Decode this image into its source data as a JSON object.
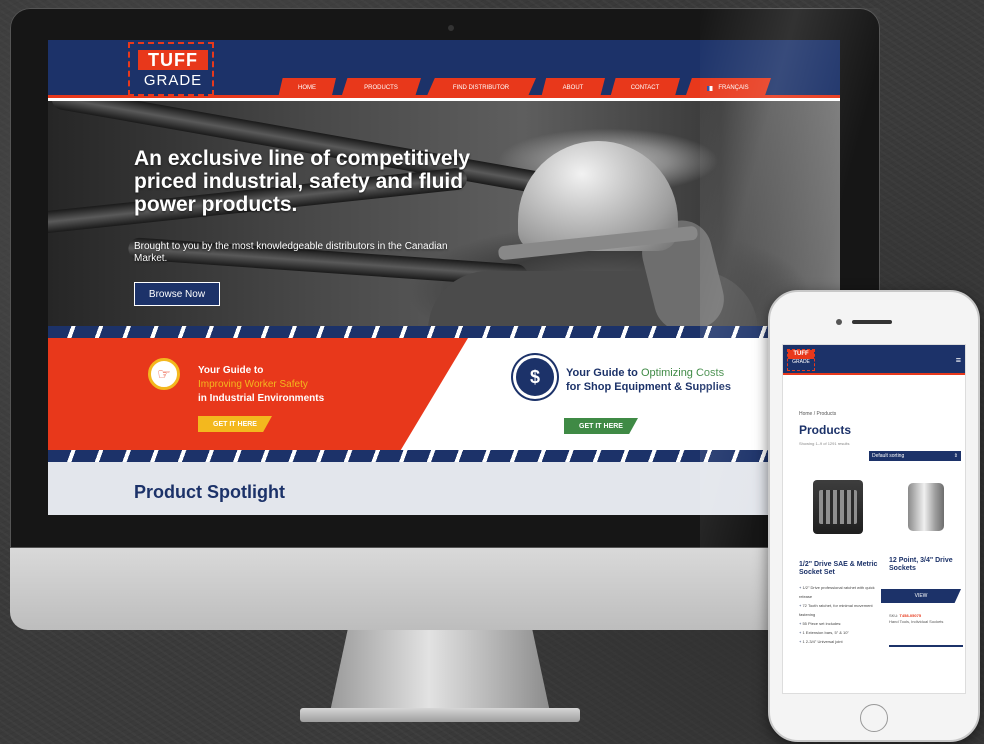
{
  "website": {
    "logo": {
      "top": "TUFF",
      "bottom": "GRADE"
    },
    "nav": [
      {
        "label": "Home",
        "w": 58
      },
      {
        "label": "Products",
        "w": 80
      },
      {
        "label": "Find Distributor",
        "w": 110
      },
      {
        "label": "About",
        "w": 64
      },
      {
        "label": "Contact",
        "w": 70
      },
      {
        "label": "Français",
        "w": 86,
        "flag": true
      }
    ],
    "hero": {
      "title": "An exclusive line of competitively priced industrial, safety and fluid power products.",
      "subtitle": "Brought to you by the most knowledgeable distributors in the Canadian Market.",
      "button": "Browse Now"
    },
    "guide_safety": {
      "prefix": "Your Guide to",
      "highlight": "Improving Worker Safety",
      "suffix": "in Industrial Environments",
      "button": "GET IT HERE"
    },
    "guide_costs": {
      "prefix": "Your Guide to",
      "highlight": "Optimizing Costs",
      "suffix": "for Shop Equipment & Supplies",
      "button": "GET IT HERE"
    },
    "spotlight": {
      "title": "Product Spotlight"
    }
  },
  "mobile": {
    "logo": {
      "top": "TUFF",
      "bottom": "GRADE"
    },
    "menu_icon": "≡",
    "breadcrumb": "Home / Products",
    "title": "Products",
    "count": "Showing 1–9 of 1291 results",
    "sort": "Default sorting",
    "product1": {
      "title": "1/2\" Drive SAE & Metric Socket Set",
      "features": [
        "1/2\" Drive professional ratchet with quick release",
        "72 Tooth ratchet, for minimal movement fastening",
        "55 Piece set includes:",
        "1 Extension bars, 5\" & 10\"",
        "1 2-3/4\" Universal joint"
      ]
    },
    "product2": {
      "title": "12 Point, 3/4\" Drive Sockets",
      "button": "VIEW",
      "sku_label": "SKU:",
      "sku": "T458-05075",
      "category": "Hand Tools, Individual Sockets"
    }
  },
  "colors": {
    "navy": "#1c3269",
    "red": "#e8381b",
    "yellow": "#f3b81e",
    "green": "#3f8a45"
  }
}
